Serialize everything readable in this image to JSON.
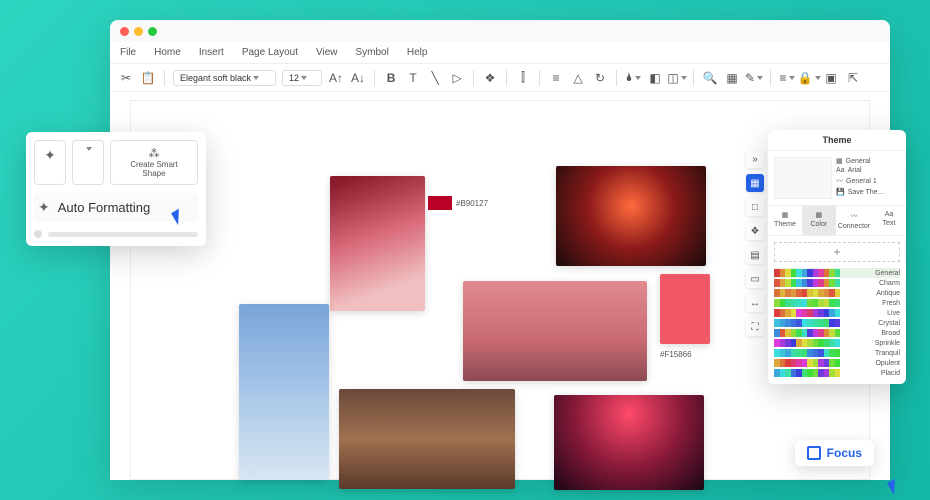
{
  "menu": {
    "file": "File",
    "home": "Home",
    "insert": "Insert",
    "page_layout": "Page Layout",
    "view": "View",
    "symbol": "Symbol",
    "help": "Help"
  },
  "toolbar": {
    "font_name": "Elegant soft black",
    "font_size": "12"
  },
  "float": {
    "create_smart_shape": "Create Smart\nShape",
    "auto_formatting": "Auto Formatting"
  },
  "swatches": {
    "hex1": "#B90127",
    "hex2": "#F15866"
  },
  "theme": {
    "title": "Theme",
    "opts": {
      "general": "General",
      "arial": "Arial",
      "general1": "General 1",
      "save": "Save The…"
    },
    "tabs": {
      "theme": "Theme",
      "color": "Color",
      "connector": "Connector",
      "text": "Text"
    }
  },
  "palettes": [
    {
      "name": "General",
      "sel": true
    },
    {
      "name": "Charm"
    },
    {
      "name": "Antique"
    },
    {
      "name": "Fresh"
    },
    {
      "name": "Live"
    },
    {
      "name": "Crystal"
    },
    {
      "name": "Broad"
    },
    {
      "name": "Sprinkle"
    },
    {
      "name": "Tranquil"
    },
    {
      "name": "Opulent"
    },
    {
      "name": "Placid"
    }
  ],
  "focus": {
    "label": "Focus"
  }
}
